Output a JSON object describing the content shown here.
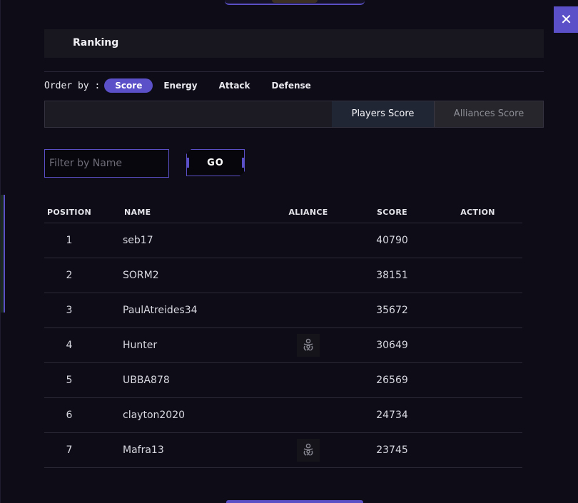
{
  "modal": {
    "title": "Ranking",
    "close_label": "✕"
  },
  "order": {
    "label": "Order by :",
    "options": [
      "Score",
      "Energy",
      "Attack",
      "Defense"
    ],
    "active": "Score"
  },
  "score_tabs": {
    "players": "Players Score",
    "alliances": "Alliances Score",
    "active": "players"
  },
  "filter": {
    "placeholder": "Filter by Name",
    "value": "",
    "go_label": "GO"
  },
  "table": {
    "headers": {
      "position": "POSITION",
      "name": "NAME",
      "alliance": "ALIANCE",
      "score": "SCORE",
      "action": "ACTION"
    },
    "rows": [
      {
        "position": "1",
        "name": "seb17",
        "alliance_icon": "",
        "score": "40790"
      },
      {
        "position": "2",
        "name": "SORM2",
        "alliance_icon": "",
        "score": "38151"
      },
      {
        "position": "3",
        "name": "PaulAtreides34",
        "alliance_icon": "",
        "score": "35672"
      },
      {
        "position": "4",
        "name": "Hunter",
        "alliance_icon": "alliance-emblem-icon",
        "score": "30649"
      },
      {
        "position": "5",
        "name": "UBBA878",
        "alliance_icon": "",
        "score": "26569"
      },
      {
        "position": "6",
        "name": "clayton2020",
        "alliance_icon": "",
        "score": "24734"
      },
      {
        "position": "7",
        "name": "Mafra13",
        "alliance_icon": "alliance-emblem-icon",
        "score": "23745"
      }
    ]
  },
  "colors": {
    "accent": "#5b50c8",
    "background": "#0d0c17",
    "panel": "#18171f"
  }
}
